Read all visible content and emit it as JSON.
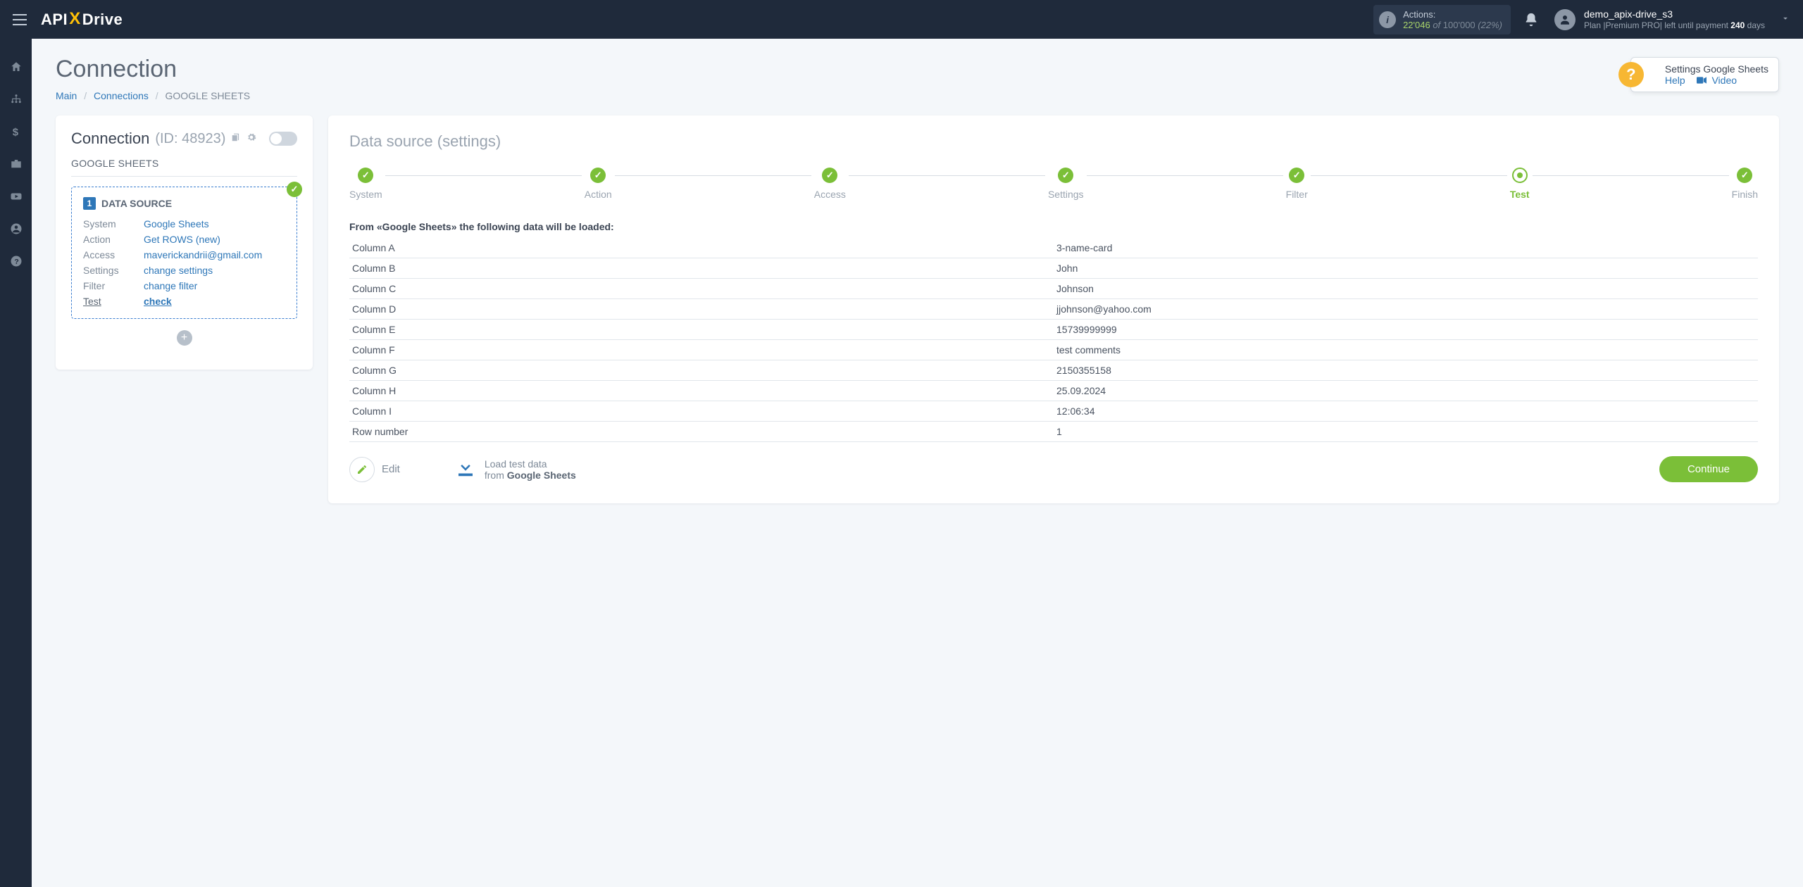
{
  "brand": {
    "part1": "API",
    "part2": "X",
    "part3": "Drive"
  },
  "topbar": {
    "actions_label": "Actions:",
    "actions_current": "22'046",
    "actions_of": " of ",
    "actions_total": "100'000",
    "actions_pct": " (22%)",
    "username": "demo_apix-drive_s3",
    "plan_prefix": "Plan |",
    "plan_name": "Premium PRO",
    "plan_mid": "| left until payment ",
    "plan_days": "240",
    "plan_suffix": " days"
  },
  "page": {
    "title": "Connection"
  },
  "breadcrumb": {
    "main": "Main",
    "connections": "Connections",
    "current": "GOOGLE SHEETS"
  },
  "help": {
    "title": "Settings Google Sheets",
    "help_link": "Help",
    "video_link": "Video"
  },
  "conn_card": {
    "title": "Connection",
    "id_label": "(ID: 48923)",
    "subhead": "GOOGLE SHEETS",
    "ds_label": "DATA SOURCE",
    "rows": {
      "system_k": "System",
      "system_v": "Google Sheets",
      "action_k": "Action",
      "action_v": "Get ROWS (new)",
      "access_k": "Access",
      "access_v": "maverickandrii@gmail.com",
      "settings_k": "Settings",
      "settings_v": "change settings",
      "filter_k": "Filter",
      "filter_v": "change filter",
      "test_k": "Test",
      "test_v": "check"
    }
  },
  "ds_card": {
    "title": "Data source",
    "title_sub": "(settings)",
    "steps": {
      "system": "System",
      "action": "Action",
      "access": "Access",
      "settings": "Settings",
      "filter": "Filter",
      "test": "Test",
      "finish": "Finish"
    },
    "load_head": "From «Google Sheets» the following data will be loaded:",
    "table": [
      {
        "k": "Column A",
        "v": "3-name-card"
      },
      {
        "k": "Column B",
        "v": "John"
      },
      {
        "k": "Column C",
        "v": "Johnson"
      },
      {
        "k": "Column D",
        "v": "jjohnson@yahoo.com"
      },
      {
        "k": "Column E",
        "v": "15739999999"
      },
      {
        "k": "Column F",
        "v": "test comments"
      },
      {
        "k": "Column G",
        "v": "2150355158"
      },
      {
        "k": "Column H",
        "v": "25.09.2024"
      },
      {
        "k": "Column I",
        "v": "12:06:34"
      },
      {
        "k": "Row number",
        "v": "1"
      }
    ],
    "edit_label": "Edit",
    "load_l1": "Load test data",
    "load_l2_prefix": "from ",
    "load_l2_bold": "Google Sheets",
    "continue": "Continue"
  }
}
